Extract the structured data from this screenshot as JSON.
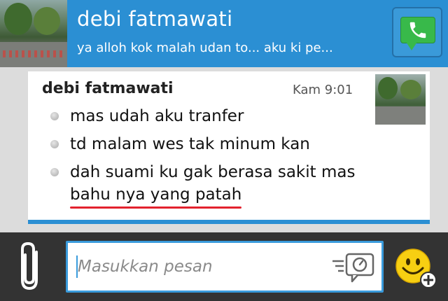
{
  "header": {
    "contact_name": "debi fatmawati",
    "last_message_preview": "ya alloh kok malah udan to... aku ki pe..."
  },
  "message": {
    "sender": "debi fatmawati",
    "time": "Kam 9:01",
    "lines": [
      "mas udah aku tranfer",
      "td malam wes tak minum kan",
      "dah suami ku gak berasa sakit mas",
      "bahu nya yang patah"
    ]
  },
  "composer": {
    "placeholder": "Masukkan pesan"
  },
  "colors": {
    "header_bg": "#2b8fd3",
    "call_green": "#38b94a",
    "input_border": "#3a9bdc",
    "underline_red": "#e3222e",
    "emoji_yellow": "#f7cf12"
  },
  "icons": [
    "phone-call-icon",
    "paperclip-icon",
    "voice-note-icon",
    "emoji-icon",
    "plus-icon"
  ]
}
